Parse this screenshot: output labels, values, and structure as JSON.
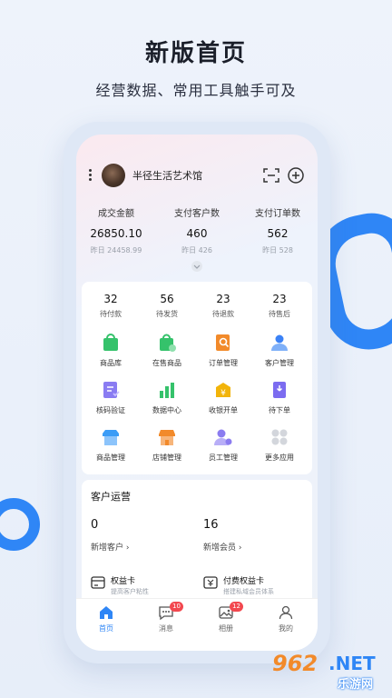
{
  "promo": {
    "headline": "新版首页",
    "subline": "经营数据、常用工具触手可及"
  },
  "header": {
    "shop_name": "半径生活艺术馆",
    "icons": [
      "more-vertical-icon",
      "scan-icon",
      "plus-circle-icon"
    ]
  },
  "stats": [
    {
      "label": "成交金额",
      "value": "26850.10",
      "prev": "昨日 24458.99"
    },
    {
      "label": "支付客户数",
      "value": "460",
      "prev": "昨日 426"
    },
    {
      "label": "支付订单数",
      "value": "562",
      "prev": "昨日 528"
    }
  ],
  "order_counts": [
    {
      "count": "32",
      "label": "待付款"
    },
    {
      "count": "56",
      "label": "待发货"
    },
    {
      "count": "23",
      "label": "待退款"
    },
    {
      "count": "23",
      "label": "待售后"
    }
  ],
  "tools": [
    {
      "label": "商品库",
      "icon": "product-library-icon",
      "color": "#35c26b"
    },
    {
      "label": "在售商品",
      "icon": "on-sale-bag-icon",
      "color": "#35c26b"
    },
    {
      "label": "订单管理",
      "icon": "order-search-icon",
      "color": "#f28a2a"
    },
    {
      "label": "客户管理",
      "icon": "customer-icon",
      "color": "#3b82f6"
    },
    {
      "label": "核码验证",
      "icon": "verify-code-icon",
      "color": "#7c6cf0"
    },
    {
      "label": "数据中心",
      "icon": "bar-chart-icon",
      "color": "#35c26b"
    },
    {
      "label": "收银开单",
      "icon": "cashier-icon",
      "color": "#f2b40a"
    },
    {
      "label": "待下单",
      "icon": "pending-order-icon",
      "color": "#7c6cf0"
    },
    {
      "label": "商品管理",
      "icon": "product-manage-icon",
      "color": "#3b9cf6"
    },
    {
      "label": "店铺管理",
      "icon": "store-icon",
      "color": "#f28a2a"
    },
    {
      "label": "员工管理",
      "icon": "staff-icon",
      "color": "#8b7cf0"
    },
    {
      "label": "更多应用",
      "icon": "more-apps-icon",
      "color": "#c9ccd3"
    }
  ],
  "operations": {
    "title": "客户运营",
    "new_customers": {
      "value": "0",
      "label": "新增客户 ›"
    },
    "new_members": {
      "value": "16",
      "label": "新增会员 ›"
    },
    "perks": [
      {
        "title": "权益卡",
        "subtitle": "提高客户粘性"
      },
      {
        "title": "付费权益卡",
        "subtitle": "搭建私域会员体系"
      }
    ]
  },
  "tabs": [
    {
      "label": "首页",
      "icon": "home-icon",
      "active": true,
      "badge": ""
    },
    {
      "label": "消息",
      "icon": "message-icon",
      "active": false,
      "badge": "10"
    },
    {
      "label": "相册",
      "icon": "album-icon",
      "active": false,
      "badge": "12"
    },
    {
      "label": "我的",
      "icon": "profile-icon",
      "active": false,
      "badge": ""
    }
  ],
  "watermark": {
    "number": "962",
    "domain": ".NET",
    "name": "乐游网"
  },
  "colors": {
    "accent": "#2f86f6",
    "badge": "#f2484f"
  }
}
